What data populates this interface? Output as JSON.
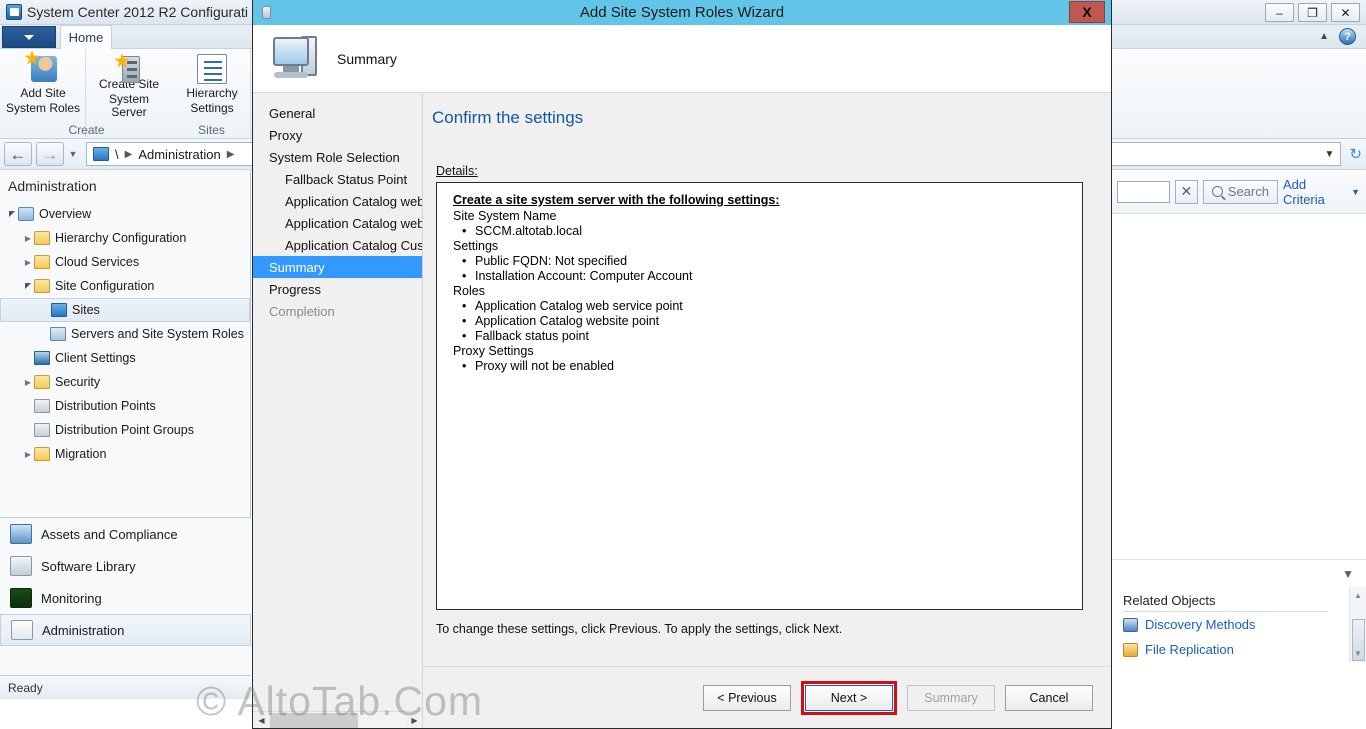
{
  "console": {
    "title": "System Center 2012 R2 Configurati",
    "window_buttons": {
      "minimize": "–",
      "restore": "❐",
      "close": "✕"
    },
    "ribbon": {
      "file_tab": "",
      "home_tab": "Home",
      "groups": [
        {
          "label": "Create",
          "buttons": [
            {
              "label_line1": "Add Site",
              "label_line2": "System Roles",
              "icon": "add-site-system-roles-icon"
            },
            {
              "label_line1": "Create Site",
              "label_line2": "System Server",
              "icon": "create-site-system-server-icon"
            }
          ]
        },
        {
          "label": "Sites",
          "buttons": [
            {
              "label_line1": "Hierarchy",
              "label_line2": "Settings",
              "icon": "hierarchy-settings-icon"
            }
          ]
        }
      ],
      "collapse_icon": "chevron-up-icon",
      "help_icon": "help-icon"
    },
    "breadcrumb": {
      "root": "\\",
      "path": "Administration",
      "icon": "sites-icon"
    },
    "left_pane": {
      "header": "Administration",
      "tree": [
        {
          "label": "Overview",
          "level": 0,
          "twisty": "expanded",
          "icon": "overview-icon"
        },
        {
          "label": "Hierarchy Configuration",
          "level": 1,
          "twisty": "collapsed",
          "icon": "folder-icon"
        },
        {
          "label": "Cloud Services",
          "level": 1,
          "twisty": "collapsed",
          "icon": "folder-icon"
        },
        {
          "label": "Site Configuration",
          "level": 1,
          "twisty": "expanded",
          "icon": "folder-icon"
        },
        {
          "label": "Sites",
          "level": 2,
          "twisty": "none",
          "icon": "sites-icon",
          "selected": true
        },
        {
          "label": "Servers and Site System Roles",
          "level": 2,
          "twisty": "none",
          "icon": "servers-icon"
        },
        {
          "label": "Client Settings",
          "level": 1,
          "twisty": "none",
          "icon": "client-settings-icon"
        },
        {
          "label": "Security",
          "level": 1,
          "twisty": "collapsed",
          "icon": "folder-icon"
        },
        {
          "label": "Distribution Points",
          "level": 1,
          "twisty": "none",
          "icon": "distribution-point-icon"
        },
        {
          "label": "Distribution Point Groups",
          "level": 1,
          "twisty": "none",
          "icon": "distribution-point-group-icon"
        },
        {
          "label": "Migration",
          "level": 1,
          "twisty": "collapsed",
          "icon": "folder-icon"
        }
      ],
      "workspaces": [
        {
          "label": "Assets and Compliance",
          "icon": "assets-and-compliance-icon",
          "active": false
        },
        {
          "label": "Software Library",
          "icon": "software-library-icon",
          "active": false
        },
        {
          "label": "Monitoring",
          "icon": "monitoring-icon",
          "active": false
        },
        {
          "label": "Administration",
          "icon": "administration-icon",
          "active": true
        }
      ],
      "status": "Ready"
    },
    "right_pane": {
      "search_placeholder": "",
      "search_value": "",
      "clear_label": "✕",
      "search_label": "Search",
      "add_criteria_label": "Add Criteria",
      "collapse_icon": "chevron-down-icon",
      "related_objects_title": "Related Objects",
      "related_objects": [
        {
          "label": "Discovery Methods",
          "icon": "discovery-methods-icon"
        },
        {
          "label": "File Replication",
          "icon": "file-replication-icon"
        }
      ]
    }
  },
  "wizard": {
    "title": "Add Site System Roles Wizard",
    "close_label": "X",
    "header_title": "Summary",
    "header_icon": "site-system-server-icon",
    "steps": [
      {
        "label": "General",
        "sub": false,
        "state": "normal"
      },
      {
        "label": "Proxy",
        "sub": false,
        "state": "normal"
      },
      {
        "label": "System Role Selection",
        "sub": false,
        "state": "normal"
      },
      {
        "label": "Fallback Status Point",
        "sub": true,
        "state": "normal"
      },
      {
        "label": "Application Catalog web",
        "sub": true,
        "state": "normal"
      },
      {
        "label": "Application Catalog webs",
        "sub": true,
        "state": "normal"
      },
      {
        "label": "Application Catalog Cust",
        "sub": true,
        "state": "normal"
      },
      {
        "label": "Summary",
        "sub": false,
        "state": "active"
      },
      {
        "label": "Progress",
        "sub": false,
        "state": "normal"
      },
      {
        "label": "Completion",
        "sub": false,
        "state": "disabled"
      }
    ],
    "heading": "Confirm the settings",
    "details_label": "Details:",
    "details": {
      "title": "Create a site system server with the following settings:",
      "groups": [
        {
          "name": "Site System Name",
          "items": [
            "SCCM.altotab.local"
          ]
        },
        {
          "name": "Settings",
          "items": [
            "Public FQDN: Not specified",
            "Installation Account: Computer Account"
          ]
        },
        {
          "name": "Roles",
          "items": [
            "Application Catalog web service point",
            "Application Catalog website point",
            "Fallback status point"
          ]
        },
        {
          "name": "Proxy Settings",
          "items": [
            "Proxy will not be enabled"
          ]
        }
      ]
    },
    "footnote": "To change these settings, click Previous. To apply the settings, click Next.",
    "buttons": {
      "previous": "< Previous",
      "next": "Next >",
      "summary": "Summary",
      "cancel": "Cancel"
    },
    "highlight_color": "#d01010"
  },
  "watermark": "© AltoTab.Com"
}
